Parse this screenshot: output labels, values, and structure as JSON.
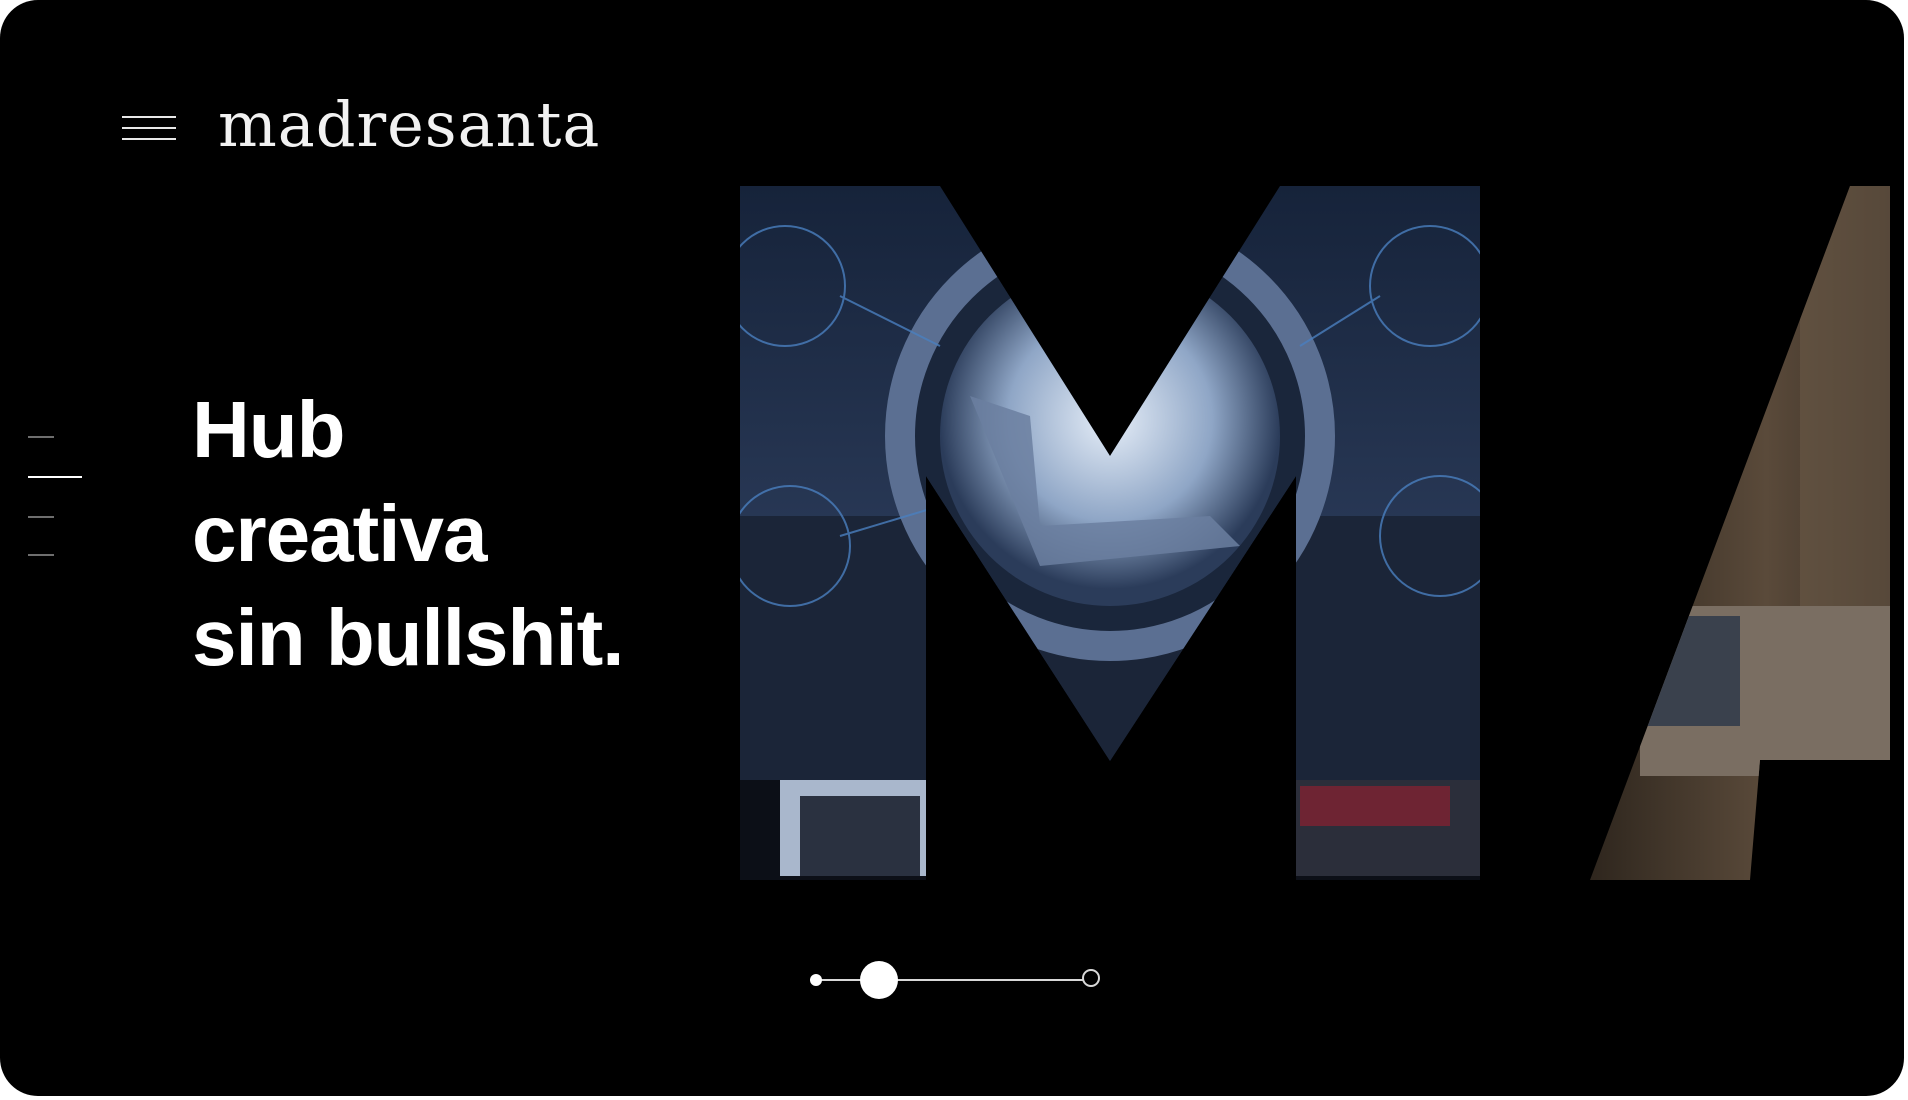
{
  "brand": {
    "name": "madresanta"
  },
  "hero": {
    "headline_lines": [
      "Hub",
      "creativa",
      "sin bullshit."
    ]
  },
  "side_nav": {
    "items": 4,
    "active_index": 1
  },
  "slider": {
    "value": 0.18
  },
  "icons": {
    "menu": "hamburger-menu-icon"
  },
  "colors": {
    "background": "#000000",
    "text": "#ffffff",
    "accent_blue": "#4a6a9a"
  }
}
